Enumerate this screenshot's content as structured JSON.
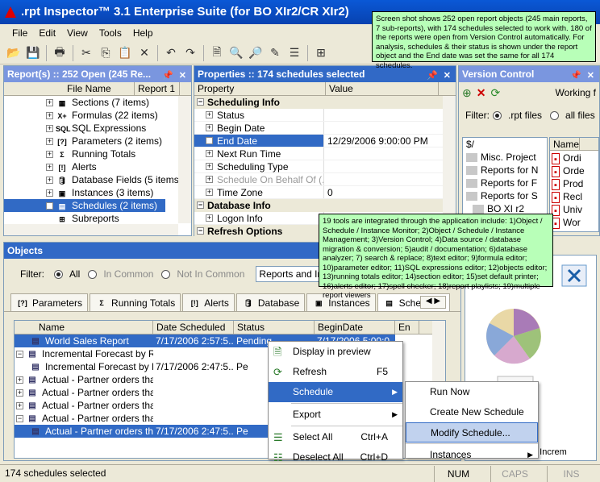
{
  "window": {
    "title": ".rpt Inspector™ 3.1 Enterprise Suite (for BO XIr2/CR XIr2)"
  },
  "menu": [
    "File",
    "Edit",
    "View",
    "Tools",
    "Help"
  ],
  "reports_panel": {
    "title": "Report(s) :: 252 Open (245 Re...",
    "cols": [
      "File Name",
      "Report 1"
    ],
    "items": [
      {
        "label": "Sections (7 items)",
        "icon": "sections-icon"
      },
      {
        "label": "Formulas (22 items)",
        "icon": "formula-icon"
      },
      {
        "label": "SQL Expressions",
        "icon": "sql-icon"
      },
      {
        "label": "Parameters (2 items)",
        "icon": "parameter-icon"
      },
      {
        "label": "Running Totals",
        "icon": "sigma-icon"
      },
      {
        "label": "Alerts",
        "icon": "alert-icon"
      },
      {
        "label": "Database Fields (5 items)",
        "icon": "database-icon"
      },
      {
        "label": "Instances (3 items)",
        "icon": "instances-icon"
      },
      {
        "label": "Schedules (2 items)",
        "icon": "schedule-icon"
      },
      {
        "label": "Subreports",
        "icon": "subreport-icon"
      }
    ]
  },
  "properties_panel": {
    "title": "Properties :: 174 schedules selected",
    "cols": [
      "Property",
      "Value"
    ],
    "rows": [
      {
        "cat": true,
        "name": "Scheduling Info"
      },
      {
        "name": "Status",
        "value": ""
      },
      {
        "name": "Begin Date",
        "value": ""
      },
      {
        "name": "End Date",
        "value": "12/29/2006 9:00:00 PM",
        "selected": true
      },
      {
        "name": "Next Run Time",
        "value": ""
      },
      {
        "name": "Scheduling Type",
        "value": ""
      },
      {
        "name": "Schedule On Behalf Of (...",
        "value": "",
        "grey": true
      },
      {
        "name": "Time Zone",
        "value": "0"
      },
      {
        "cat": true,
        "name": "Database Info"
      },
      {
        "name": "Logon Info",
        "value": ""
      },
      {
        "cat": true,
        "name": "Refresh Options"
      }
    ]
  },
  "version_panel": {
    "title": "Version Control",
    "working": "Working f",
    "filter_label": "Filter:",
    "opt_rpt": ".rpt files",
    "opt_all": "all files",
    "root": "$/",
    "folders": [
      "Misc. Project",
      "Reports for N",
      "Reports for F",
      "Reports for S",
      "BO XI r2"
    ],
    "files_hdr": "Name",
    "files": [
      "Ordi",
      "Orde",
      "Prod",
      "Recl",
      "Univ",
      "Wor"
    ]
  },
  "tooltip1": "Screen shot shows 252 open report objects (245 main reports, 7 sub-reports), with 174 schedules selected to work with. 180 of the reports were open from Version Control automatically. For analysis, schedules & their status is shown under the report object and the End date was set the same for all 174 schedules.",
  "tooltip2": "19 tools are integrated through the application include: 1)Object / Schedule / Instance Monitor; 2)Object / Schedule / Instance Management; 3)Version Control; 4)Data source / database migration & conversion; 5)audit / documentation; 6)database analyzer; 7) search & replace; 8)text editor; 9)formula editor; 10)parameter editor; 11)SQL expressions editor; 12)objects editor; 13)running totals editor; 14)section editor; 15)set default printer; 16)alerts editor; 17)spell checker; 18)report playlists; 19)multiple report viewers",
  "objects_panel": {
    "title": "Objects",
    "filter_label": "Filter:",
    "opt_all": "All",
    "opt_common": "In Common",
    "opt_notcommon": "Not In Common",
    "combo": "Reports and Instan",
    "tabs": [
      "Parameters",
      "Running Totals",
      "Alerts",
      "Database",
      "Instances",
      "Schedules"
    ],
    "cols": [
      "Name",
      "Date Scheduled",
      "Status",
      "BeginDate",
      "En"
    ],
    "rows": [
      {
        "name": "World Sales Report",
        "date": "7/17/2006 2:57:5...",
        "status": "Pending",
        "begin": "7/17/2006 5:00:0...",
        "sel": true,
        "indent": 2
      },
      {
        "name": "Incremental Forecast by Region f...",
        "date": "",
        "status": "",
        "begin": "",
        "indent": 0,
        "pm": "−"
      },
      {
        "name": "Incremental Forecast by Regi...",
        "date": "7/17/2006 2:47:5...",
        "status": "Pe",
        "begin": "",
        "indent": 2
      },
      {
        "name": "Actual - Partner orders that need ...",
        "date": "",
        "status": "",
        "begin": "",
        "indent": 0,
        "pm": "+"
      },
      {
        "name": "Actual - Partner orders that need ...",
        "date": "",
        "status": "",
        "begin": "",
        "indent": 0,
        "pm": "+"
      },
      {
        "name": "Actual - Partner orders that need ...",
        "date": "",
        "status": "",
        "begin": "",
        "indent": 0,
        "pm": "+"
      },
      {
        "name": "Actual - Partner orders that need ...",
        "date": "",
        "status": "",
        "begin": "",
        "indent": 0,
        "pm": "−"
      },
      {
        "name": "Actual - Partner orders that ne...",
        "date": "7/17/2006 2:47:5...",
        "status": "Pe",
        "begin": "",
        "sel": true,
        "indent": 2
      }
    ]
  },
  "context_menu": [
    {
      "label": "Display in preview",
      "icon": "preview-icon"
    },
    {
      "label": "Refresh",
      "shortcut": "F5",
      "icon": "refresh-icon"
    },
    {
      "label": "Schedule",
      "sub": true,
      "hl": true
    },
    {
      "label": "Export",
      "sub": true
    },
    {
      "label": "Select All",
      "shortcut": "Ctrl+A",
      "icon": "select-all-icon"
    },
    {
      "label": "Deselect All",
      "shortcut": "Ctrl+D",
      "icon": "deselect-all-icon"
    }
  ],
  "submenu": [
    {
      "label": "Run Now"
    },
    {
      "label": "Create New Schedule"
    },
    {
      "label": "Modify Schedule...",
      "hl": true
    },
    {
      "label": "Instances",
      "sub": true
    }
  ],
  "preview_caption": "World Sales Increm",
  "status": {
    "text": "174 schedules selected",
    "num": "NUM",
    "caps": "CAPS",
    "ins": "INS"
  },
  "colors": {
    "title": "#0a58d6",
    "panel_active": "#3169c6",
    "panel": "#7a96df",
    "selection": "#316ac5",
    "tooltip": "#b8ffb8"
  }
}
